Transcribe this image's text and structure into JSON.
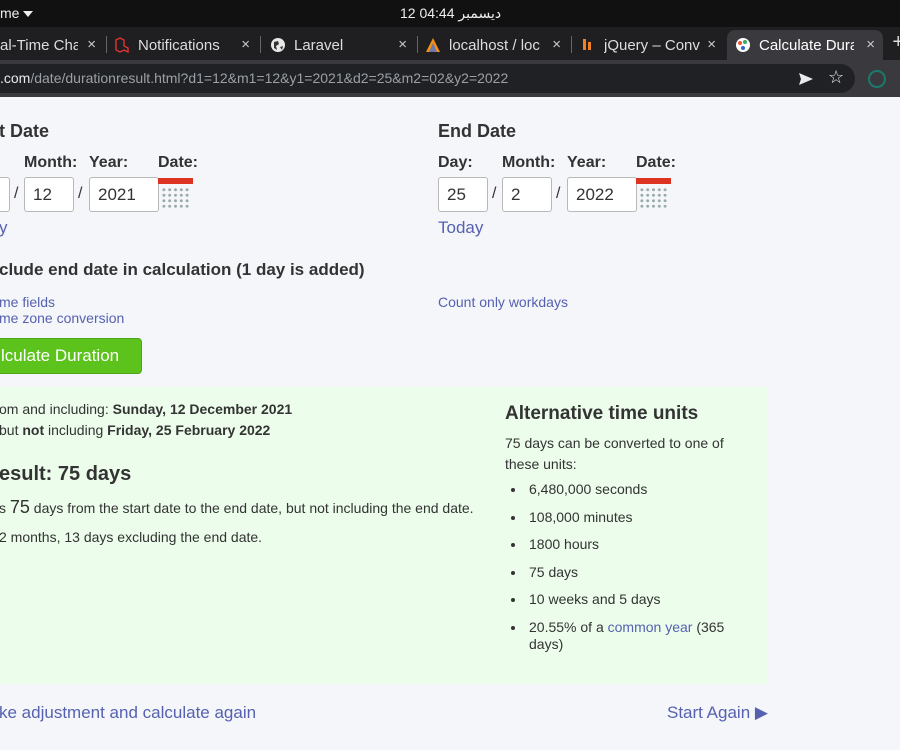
{
  "os": {
    "app_label": "me",
    "clock": "12 ديسمبر  04:44"
  },
  "tabs": [
    {
      "label": "al-Time Cha",
      "close": "×"
    },
    {
      "label": "Notifications",
      "close": "×"
    },
    {
      "label": "Laravel",
      "close": "×"
    },
    {
      "label": "localhost / loc",
      "close": "×"
    },
    {
      "label": "jQuery – Conv",
      "close": "×"
    },
    {
      "label": "Calculate Dura",
      "close": "×",
      "active": true
    }
  ],
  "newtab": "+",
  "address": {
    "host": ".com",
    "path": "/date/durationresult.html?d1=12&m1=12&y1=2021&d2=25&m2=02&y2=2022"
  },
  "start": {
    "heading": "t Date",
    "labels": {
      "month": "Month:",
      "year": "Year:",
      "date": "Date:"
    },
    "month": "12",
    "year": "2021",
    "today": "y"
  },
  "end": {
    "heading": "End Date",
    "labels": {
      "day": "Day:",
      "month": "Month:",
      "year": "Year:",
      "date": "Date:"
    },
    "day": "25",
    "month": "2",
    "year": "2022",
    "today": "Today"
  },
  "include_end": "clude end date in calculation (1 day is added)",
  "time_fields": "me fields",
  "time_zone": "me zone conversion",
  "workdays": "Count only workdays",
  "calc_button": "lculate Duration",
  "result": {
    "from_prefix": "om and including: ",
    "from_date": "Sunday, 12 December 2021",
    "to_prefix": " but ",
    "to_not": "not",
    "to_mid": " including ",
    "to_date": "Friday, 25 February 2022",
    "heading": "esult: 75 days",
    "line1_prefix": "s ",
    "line1_num": "75",
    "line1_suffix": " days from the start date to the end date, but not including the end date.",
    "line2": "2 months, 13 days excluding the end date."
  },
  "alt": {
    "heading": "Alternative time units",
    "intro": [
      "75 days can be converted to one of",
      "these units:"
    ],
    "items": [
      "6,480,000 seconds",
      "108,000 minutes",
      "1800 hours",
      "75 days",
      "10 weeks and 5 days"
    ],
    "last_prefix": "20.55% of a ",
    "last_link": "common year",
    "last_suffix": " (365",
    "last_suffix2": "days)"
  },
  "bottom": {
    "adjust": "ke adjustment and calculate again",
    "start_again": "Start Again ▶"
  }
}
